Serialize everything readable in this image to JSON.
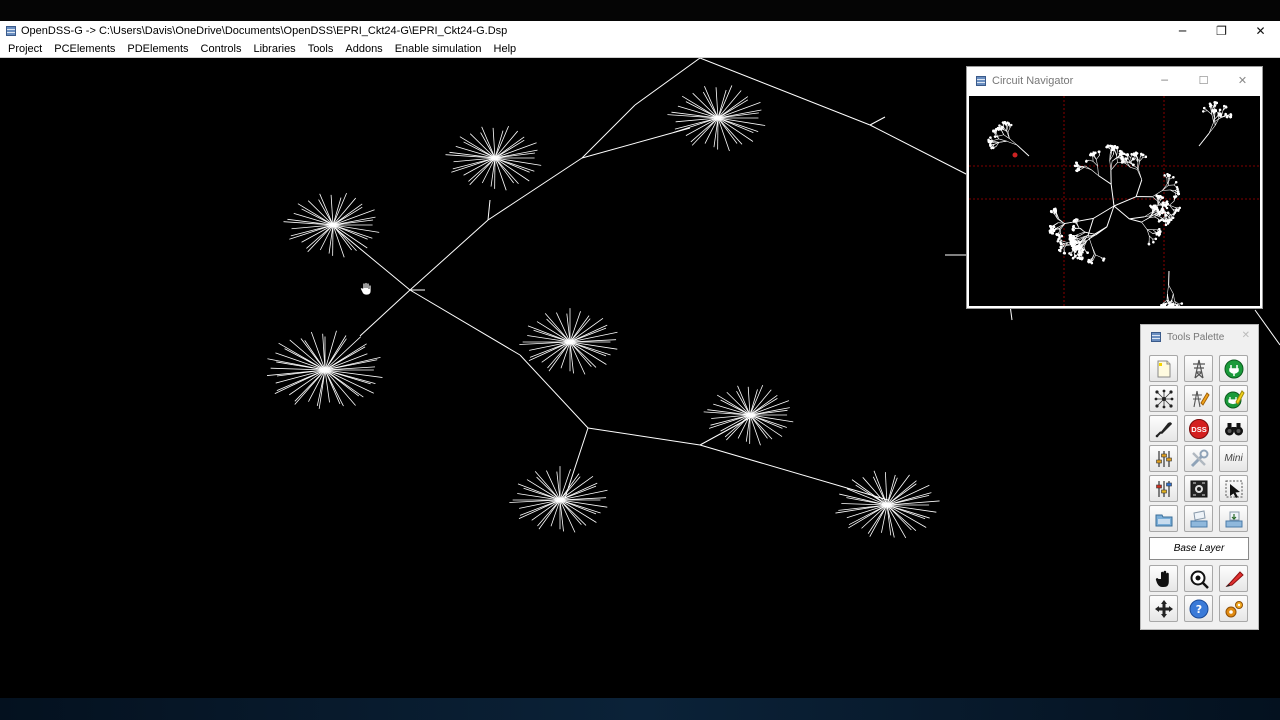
{
  "window": {
    "title": "OpenDSS-G -> C:\\Users\\Davis\\OneDrive\\Documents\\OpenDSS\\EPRI_Ckt24-G\\EPRI_Ckt24-G.Dsp",
    "minimize_glyph": "─",
    "maximize_glyph": "❐",
    "close_glyph": "✕"
  },
  "menu": {
    "items": [
      "Project",
      "PCElements",
      "PDElements",
      "Controls",
      "Libraries",
      "Tools",
      "Addons",
      "Enable simulation",
      "Help"
    ]
  },
  "navigator": {
    "title": "Circuit Navigator",
    "minimize_glyph": "─",
    "maximize_glyph": "☐",
    "close_glyph": "✕"
  },
  "palette": {
    "title": "Tools Palette",
    "close_glyph": "✕",
    "base_layer_label": "Base Layer",
    "mini_label": "Mini",
    "dss_label": "DSS",
    "buttons": [
      {
        "name": "new-file-icon"
      },
      {
        "name": "transmission-tower-icon"
      },
      {
        "name": "green-plug-icon"
      },
      {
        "name": "network-nodes-icon"
      },
      {
        "name": "tower-edit-icon"
      },
      {
        "name": "green-plug-edit-icon"
      },
      {
        "name": "probe-pen-icon"
      },
      {
        "name": "dss-logo-icon"
      },
      {
        "name": "binoculars-icon"
      },
      {
        "name": "sliders-icon"
      },
      {
        "name": "tools-icon"
      },
      {
        "name": "mini-icon"
      },
      {
        "name": "sliders-color-icon"
      },
      {
        "name": "circuit-board-icon"
      },
      {
        "name": "select-cursor-icon"
      },
      {
        "name": "open-folder-icon"
      },
      {
        "name": "save-tray-icon"
      },
      {
        "name": "export-tray-icon"
      },
      {
        "name": "pan-hand-icon"
      },
      {
        "name": "zoom-magnifier-icon"
      },
      {
        "name": "highlighter-icon"
      },
      {
        "name": "move-arrows-icon"
      },
      {
        "name": "help-icon"
      },
      {
        "name": "settings-gears-icon"
      }
    ]
  },
  "colors": {
    "canvas_background": "#000000",
    "feeder_lines": "#ffffff",
    "grid_lines": "#aa0000",
    "selected_marker": "#cc2222"
  }
}
